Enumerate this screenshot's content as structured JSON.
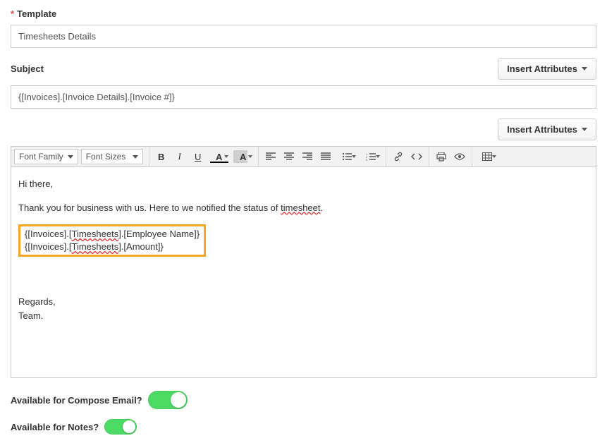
{
  "fields": {
    "template_label": "Template",
    "template_value": "Timesheets Details",
    "subject_label": "Subject",
    "subject_value": "{[Invoices].[Invoice Details].[Invoice #]}"
  },
  "buttons": {
    "insert_attributes": "Insert Attributes"
  },
  "editor": {
    "font_family_label": "Font Family",
    "font_sizes_label": "Font Sizes",
    "body": {
      "greeting": "Hi there,",
      "para1_a": "Thank you for business with us. Here to we notified the status of ",
      "para1_squiggle": "timesheet",
      "para1_c": ".",
      "box_l1a": "{[Invoices].[",
      "box_l1b": "Timesheets",
      "box_l1c": "].[Employee Name]}",
      "box_l2a": "{[Invoices].[",
      "box_l2b": "Timesheets",
      "box_l2c": "].[Amount]}",
      "signoff1": "Regards,",
      "signoff2": "Team."
    }
  },
  "toggles": {
    "compose_label": "Available for Compose Email?",
    "notes_label": "Available for Notes?"
  }
}
